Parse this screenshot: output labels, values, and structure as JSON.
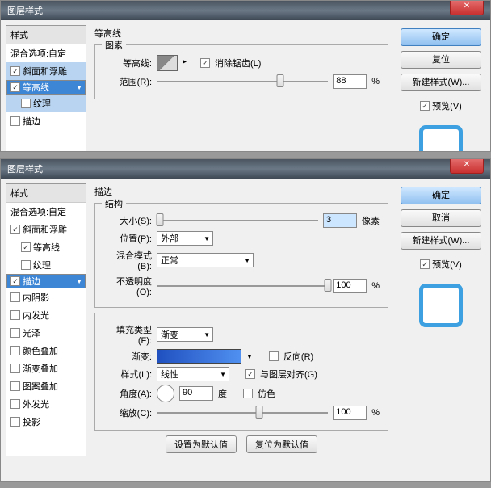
{
  "d1": {
    "title": "图层样式",
    "sidebar": {
      "hdr": "样式",
      "blend": "混合选项:自定",
      "items": [
        {
          "l": "斜面和浮雕",
          "ck": true
        },
        {
          "l": "等高线",
          "ck": true
        },
        {
          "l": "纹理",
          "ck": false
        },
        {
          "l": "描边",
          "ck": false
        }
      ]
    },
    "main": {
      "group": "等高线",
      "inner": "图素",
      "contour": "等高线:",
      "anti": "消除锯齿(L)",
      "range": "范围(R):",
      "rangeVal": "88",
      "pct": "%"
    },
    "right": {
      "ok": "确定",
      "reset": "复位",
      "new": "新建样式(W)...",
      "preview": "预览(V)"
    }
  },
  "d2": {
    "title": "图层样式",
    "sidebar": {
      "hdr": "样式",
      "blend": "混合选项:自定",
      "items": [
        {
          "l": "斜面和浮雕",
          "ck": true
        },
        {
          "l": "等高线",
          "ck": true
        },
        {
          "l": "纹理",
          "ck": false
        },
        {
          "l": "描边",
          "ck": true
        },
        {
          "l": "内阴影",
          "ck": false
        },
        {
          "l": "内发光",
          "ck": false
        },
        {
          "l": "光泽",
          "ck": false
        },
        {
          "l": "颜色叠加",
          "ck": false
        },
        {
          "l": "渐变叠加",
          "ck": false
        },
        {
          "l": "图案叠加",
          "ck": false
        },
        {
          "l": "外发光",
          "ck": false
        },
        {
          "l": "投影",
          "ck": false
        }
      ]
    },
    "main": {
      "group": "描边",
      "struct": "结构",
      "size": "大小(S):",
      "sizeVal": "3",
      "px": "像素",
      "pos": "位置(P):",
      "posVal": "外部",
      "blend": "混合模式(B):",
      "blendVal": "正常",
      "opacity": "不透明度(O):",
      "opVal": "100",
      "pct": "%",
      "fillType": "填充类型(F):",
      "fillVal": "渐变",
      "grad": "渐变:",
      "reverse": "反向(R)",
      "style": "样式(L):",
      "styleVal": "线性",
      "align": "与图层对齐(G)",
      "angle": "角度(A):",
      "angleVal": "90",
      "deg": "度",
      "dither": "仿色",
      "scale": "缩放(C):",
      "scaleVal": "100",
      "setDef": "设置为默认值",
      "resetDef": "复位为默认值"
    },
    "right": {
      "ok": "确定",
      "cancel": "取消",
      "new": "新建样式(W)...",
      "preview": "预览(V)"
    }
  }
}
